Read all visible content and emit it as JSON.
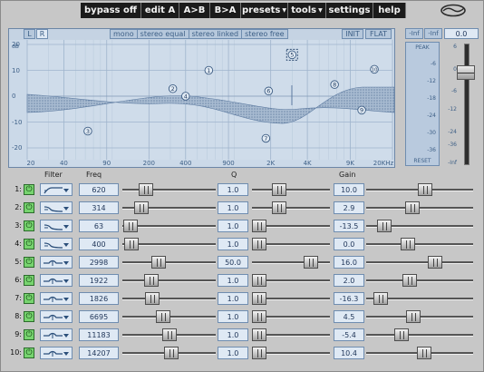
{
  "toolbar": {
    "items": [
      {
        "label": "bypass off",
        "caret": false
      },
      {
        "label": "edit A",
        "caret": false
      },
      {
        "label": "A>B",
        "caret": false
      },
      {
        "label": "B>A",
        "caret": false
      },
      {
        "label": "presets",
        "caret": true
      },
      {
        "label": "tools",
        "caret": true
      },
      {
        "label": "settings",
        "caret": false
      },
      {
        "label": "help",
        "caret": false
      }
    ],
    "logo_icon": "waves-logo-icon"
  },
  "graph": {
    "tabs": [
      {
        "label": "L",
        "selected": false
      },
      {
        "label": "R",
        "selected": true
      }
    ],
    "modes": [
      "mono",
      "stereo equal",
      "stereo linked",
      "stereo free"
    ],
    "buttons": {
      "init": "INIT",
      "flat": "FLAT"
    },
    "db_label": "dB",
    "y_ticks": [
      "20",
      "10",
      "0",
      "-10",
      "-20"
    ],
    "x_ticks": [
      "20",
      "40",
      "90",
      "200",
      "400",
      "900",
      "2K",
      "4K",
      "9K",
      "20KHz"
    ],
    "band_markers": [
      {
        "label": "1",
        "freq": 620,
        "gain": 10.0
      },
      {
        "label": "2",
        "freq": 314,
        "gain": 2.9
      },
      {
        "label": "3",
        "freq": 63,
        "gain": -13.5
      },
      {
        "label": "4",
        "freq": 400,
        "gain": 0.0
      },
      {
        "label": "5",
        "freq": 2998,
        "gain": 16.0
      },
      {
        "label": "6",
        "freq": 1922,
        "gain": 2.0
      },
      {
        "label": "7",
        "freq": 1826,
        "gain": -16.3
      },
      {
        "label": "8",
        "freq": 6695,
        "gain": 4.5
      },
      {
        "label": "9",
        "freq": 11183,
        "gain": -5.4
      },
      {
        "label": "10",
        "freq": 14207,
        "gain": 10.4
      }
    ]
  },
  "meter": {
    "header_left": "-Inf",
    "header_mid": "-Inf",
    "value": "0.0",
    "peak_label": "PEAK",
    "reset_label": "RESET",
    "meter_ticks": [
      "-6",
      "-12",
      "-18",
      "-24",
      "-30",
      "-36"
    ],
    "fader_ticks": [
      "6",
      "0",
      "-6",
      "-12",
      "-24",
      "-36",
      "-Inf"
    ]
  },
  "table": {
    "headers": {
      "filter": "Filter",
      "freq": "Freq",
      "q": "Q",
      "gain": "Gain"
    },
    "power_icon": "power-icon",
    "rows": [
      {
        "num": "1:",
        "filter": "low-cut",
        "freq": "620",
        "q": "1.0",
        "gain": "10.0",
        "freq_pos": 0.21,
        "q_pos": 0.32,
        "gain_pos": 0.56
      },
      {
        "num": "2:",
        "filter": "low-shelf",
        "freq": "314",
        "q": "1.0",
        "gain": "2.9",
        "freq_pos": 0.15,
        "q_pos": 0.32,
        "gain_pos": 0.42
      },
      {
        "num": "3:",
        "filter": "low-shelf",
        "freq": "63",
        "q": "1.0",
        "gain": "-13.5",
        "freq_pos": 0.01,
        "q_pos": 0.0,
        "gain_pos": 0.12
      },
      {
        "num": "4:",
        "filter": "low-shelf",
        "freq": "400",
        "q": "1.0",
        "gain": "0.0",
        "freq_pos": 0.02,
        "q_pos": 0.0,
        "gain_pos": 0.37
      },
      {
        "num": "5:",
        "filter": "bell",
        "freq": "2998",
        "q": "50.0",
        "gain": "16.0",
        "freq_pos": 0.37,
        "q_pos": 0.82,
        "gain_pos": 0.67
      },
      {
        "num": "6:",
        "filter": "bell",
        "freq": "1922",
        "q": "1.0",
        "gain": "2.0",
        "freq_pos": 0.28,
        "q_pos": 0.0,
        "gain_pos": 0.39
      },
      {
        "num": "7:",
        "filter": "bell",
        "freq": "1826",
        "q": "1.0",
        "gain": "-16.3",
        "freq_pos": 0.29,
        "q_pos": 0.0,
        "gain_pos": 0.08
      },
      {
        "num": "8:",
        "filter": "bell",
        "freq": "6695",
        "q": "1.0",
        "gain": "4.5",
        "freq_pos": 0.43,
        "q_pos": 0.0,
        "gain_pos": 0.43
      },
      {
        "num": "9:",
        "filter": "bell",
        "freq": "11183",
        "q": "1.0",
        "gain": "-5.4",
        "freq_pos": 0.5,
        "q_pos": 0.0,
        "gain_pos": 0.3
      },
      {
        "num": "10:",
        "filter": "bell",
        "freq": "14207",
        "q": "1.0",
        "gain": "10.4",
        "freq_pos": 0.53,
        "q_pos": 0.0,
        "gain_pos": 0.55
      }
    ]
  }
}
